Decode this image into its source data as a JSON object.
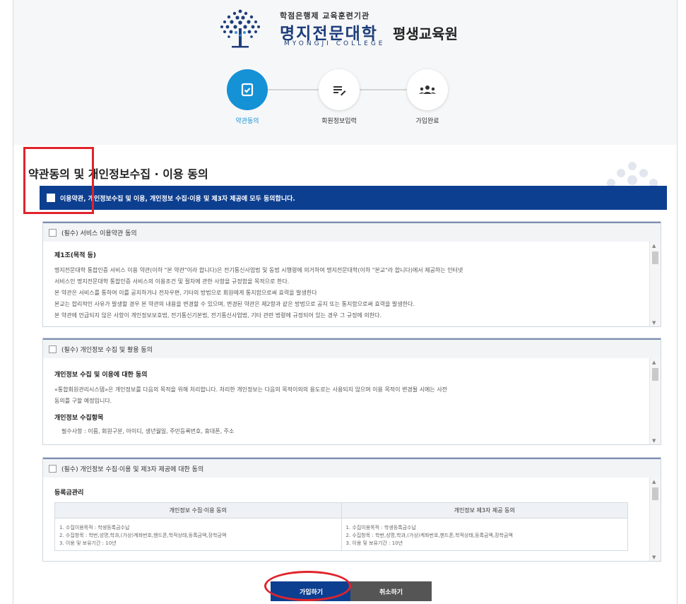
{
  "header": {
    "institution_sub": "학점은행제 교육훈련기관",
    "college_name": "명지전문대학",
    "center_name": "평생교육원",
    "english_name": "MYONGJI COLLEGE"
  },
  "steps": [
    {
      "label": "약관동의",
      "icon": "checklist-icon",
      "state": "active"
    },
    {
      "label": "회원정보입력",
      "icon": "edit-list-icon",
      "state": "inactive"
    },
    {
      "label": "가입완료",
      "icon": "users-icon",
      "state": "inactive"
    }
  ],
  "colors": {
    "accent": "#1591d6",
    "navy": "#0d3f91",
    "highlight": "#e0242c"
  },
  "main": {
    "title": "약관동의 및 개인정보수집 · 이용 동의",
    "agree_all": "이용약관, 개인정보수집 및 이용, 개인정보 수집·이용 및 제3자 제공에 모두 동의합니다."
  },
  "sections": {
    "terms": {
      "header": "(필수) 서비스 이용약관 동의",
      "title": "제1조(목적 등)",
      "lines": [
        "명지전문대학 통합인증 서비스 이용 약관(이하 \"본 약관\"이라 합니다)은 전기통신사업법 및 동법 시행령에 의거하여 명지전문대학(이하 \"본교\"라 합니다)에서 제공하는 인터넷",
        "서비스인 명지전문대학 통합인증 서비스의 이용조건 및 절차에 관한 사항을 규정함을 목적으로 한다.",
        "본 약관은 서비스를 통하여 이를 공지하거나 전자우편, 기타의 방법으로 회원에게 통지함으로써 효력을 발생한다",
        "본교는 합리적인 사유가 발생할 경우 본 약관의 내용을 변경할 수 있으며, 변경된 약관은 제2항과 같은 방법으로 공지 또는 통지함으로써 효력을 발생한다.",
        "본 약관에 언급되지 않은 사항이 개인정보보호법, 전기통신기본법, 전기통신사업법, 기타 관련 법령에 규정되어 있는 경우 그 규정에 의한다."
      ]
    },
    "privacy": {
      "header": "(필수) 개인정보 수집 및 활용 동의",
      "title": "개인정보 수집 및 이용에 대한 동의",
      "lines": [
        "«통합회원관리시스템»은 개인정보를 다음의 목적을 위해 처리합니다. 처리한 개인정보는 다음의 목적이외의 용도로는 사용되지 않으며 이용 목적이 변경될 시에는 사전",
        "동의를 구할 예정입니다."
      ],
      "subtitle": "개인정보 수집항목",
      "item_line": "필수사항 : 이름, 회원구분, 아이디, 생년월일, 주민등록번호, 휴대폰, 주소"
    },
    "third_party": {
      "header": "(필수) 개인정보 수집·이용 및 제3자 제공에 대한 동의",
      "title": "등록금관리",
      "table": {
        "headers": [
          "개인정보 수집·이용 동의",
          "개인정보 제3자 제공 동의"
        ],
        "left_lines": [
          "1. 수집이용목적 : 학생등록금수납",
          "2. 수집항목 : 학번,성명,학과,(가상)계좌번호,핸드폰,학적상태,등록금액,장학금액",
          "3. 이용 및 보유기간 : 10년"
        ],
        "right_lines": [
          "1. 수집이용목적 : 학생등록금수납",
          "2. 수집항목 : 학번,성명,학과,(가상)계좌번호,핸드폰,학적상태,등록금액,장학금액",
          "3. 이용 및 보유기간 : 10년"
        ]
      }
    }
  },
  "buttons": {
    "join": "가입하기",
    "cancel": "취소하기"
  }
}
